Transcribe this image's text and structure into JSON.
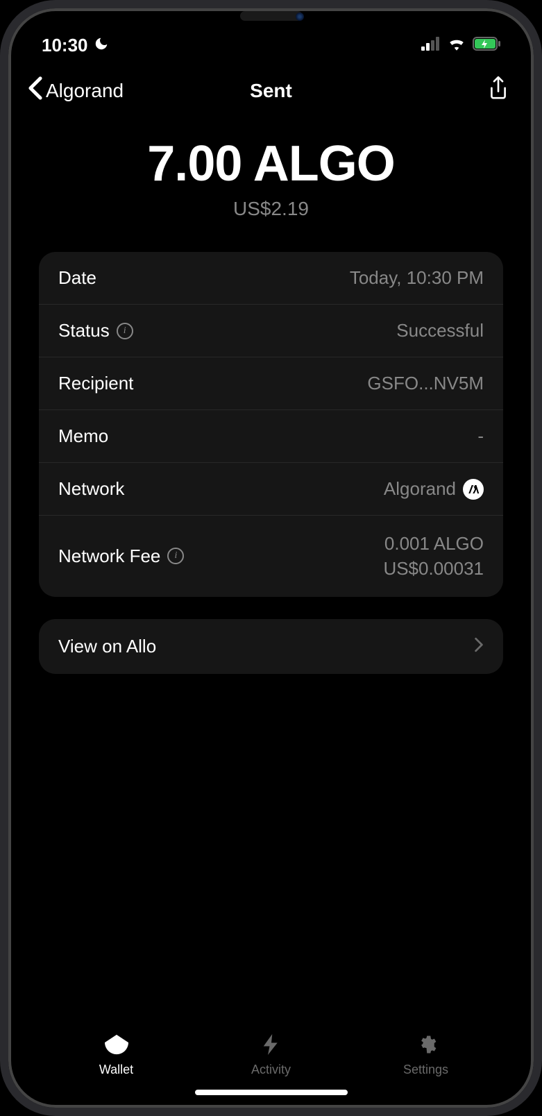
{
  "status_bar": {
    "time": "10:30"
  },
  "nav": {
    "back_label": "Algorand",
    "title": "Sent"
  },
  "amount": {
    "main": "7.00 ALGO",
    "sub": "US$2.19"
  },
  "details": [
    {
      "label": "Date",
      "value": "Today, 10:30 PM",
      "info": false,
      "icon": null
    },
    {
      "label": "Status",
      "value": "Successful",
      "info": true,
      "icon": null
    },
    {
      "label": "Recipient",
      "value": "GSFO...NV5M",
      "info": false,
      "icon": null
    },
    {
      "label": "Memo",
      "value": "-",
      "info": false,
      "icon": null
    },
    {
      "label": "Network",
      "value": "Algorand",
      "info": false,
      "icon": "algorand"
    },
    {
      "label": "Network Fee",
      "value": "0.001 ALGO",
      "value2": "US$0.00031",
      "info": true,
      "icon": null
    }
  ],
  "action": {
    "view_label": "View on Allo"
  },
  "tabs": {
    "wallet": "Wallet",
    "activity": "Activity",
    "settings": "Settings"
  }
}
